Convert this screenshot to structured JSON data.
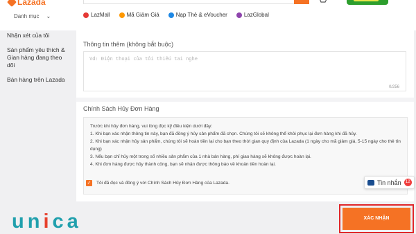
{
  "header": {
    "logo_text": "Lazada",
    "category_label": "Danh mục",
    "quick_links": [
      {
        "label": "LazMall",
        "color": "#e53935"
      },
      {
        "label": "Mã Giảm Giá",
        "color": "#ff9800"
      },
      {
        "label": "Nạp Thẻ & eVoucher",
        "color": "#1e88e5"
      },
      {
        "label": "LazGlobal",
        "color": "#8e44ad"
      }
    ]
  },
  "sidebar": {
    "items": [
      "Nhận xét của tôi",
      "Sản phẩm yêu thích & Gian hàng đang theo dõi",
      "Bán hàng trên Lazada"
    ]
  },
  "extra_info": {
    "title": "Thông tin thêm (không bắt buộc)",
    "placeholder": "Vd: Điện thoại của tôi thiếu tai nghe",
    "counter": "0/256"
  },
  "policy": {
    "title": "Chính Sách Hủy Đơn Hàng",
    "intro": "Trước khi hủy đơn hàng, vui lòng đọc kỹ điều kiện dưới đây:",
    "rules": [
      "1. Khi bạn xác nhận thông tin này, bạn đã đồng ý hủy sản phẩm đã chọn. Chúng tôi sẽ không thể khôi phục lại đơn hàng khi đã hủy.",
      "2. Khi bạn xác nhận hủy sản phẩm, chúng tôi sẽ hoàn tiền lại cho bạn theo thời gian quy định của Lazada (1 ngày cho mã giảm giá, 5-15 ngày cho thẻ tín dụng)",
      "3. Nếu bạn chỉ hủy một trong số nhiều sản phẩm của 1 nhà bán hàng, phí giao hàng sẽ không được hoàn lại.",
      "4. Khi đơn hàng được hủy thành công, bạn sẽ nhận được thông báo về khoản tiền hoàn lại."
    ],
    "agree_label": "Tôi đã đọc và đồng ý với Chính Sách Hủy Đơn Hàng của Lazada."
  },
  "chat": {
    "label": "Tin nhắn",
    "badge": "12"
  },
  "confirm_label": "XÁC NHẬN",
  "watermark": {
    "text_main": "un",
    "text_accent": "i",
    "text_end": "ca"
  },
  "colors": {
    "accent": "#f57224",
    "highlight": "#e0262a",
    "watermark": "#21a0ad"
  }
}
